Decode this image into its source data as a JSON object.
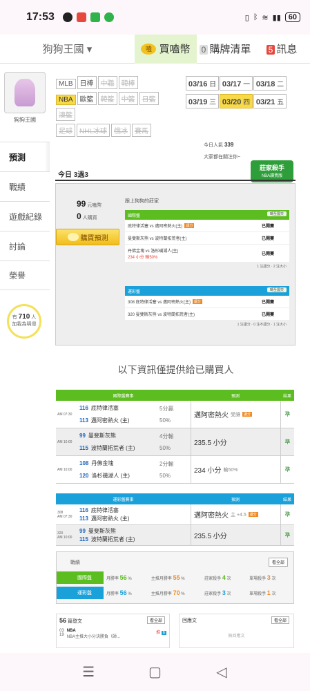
{
  "status": {
    "time": "17:53",
    "battery": "60"
  },
  "topnav": {
    "site": "狗狗王國 ▾",
    "buy_label": "買嗑幣",
    "coin_text": "嗑",
    "cart_count": "0",
    "cart_label": "購牌清單",
    "msg_count": "5",
    "msg_label": "訊息"
  },
  "sidebar": {
    "user_name": "狗狗王國",
    "items": [
      {
        "label": "預測"
      },
      {
        "label": "戰績"
      },
      {
        "label": "遊戲紀錄"
      },
      {
        "label": "討論"
      },
      {
        "label": "榮譽"
      }
    ],
    "followers_pre": "有",
    "followers": "710",
    "followers_post": "人",
    "followers_sub": "加我為明燈"
  },
  "sports": {
    "row1": [
      {
        "label": "MLB",
        "state": "normal"
      },
      {
        "label": "日棒",
        "state": "normal"
      },
      {
        "label": "中職",
        "state": "dim"
      },
      {
        "label": "韓棒",
        "state": "dim"
      }
    ],
    "row2": [
      {
        "label": "NBA",
        "state": "sel"
      },
      {
        "label": "歐籃",
        "state": "normal"
      },
      {
        "label": "韓籃",
        "state": "dim"
      },
      {
        "label": "中籃",
        "state": "dim"
      },
      {
        "label": "日籃",
        "state": "dim"
      }
    ],
    "row3": [
      {
        "label": "澳籃",
        "state": "dim"
      }
    ],
    "row4": [
      {
        "label": "足球",
        "state": "dim"
      },
      {
        "label": "NHL冰球",
        "state": "dim"
      },
      {
        "label": "俄冰",
        "state": "dim"
      },
      {
        "label": "賽馬",
        "state": "dim"
      }
    ]
  },
  "dates": [
    {
      "date": "03/16",
      "day": "日",
      "sel": false
    },
    {
      "date": "03/17",
      "day": "一",
      "sel": false
    },
    {
      "date": "03/18",
      "day": "二",
      "sel": false
    },
    {
      "date": "03/19",
      "day": "三",
      "sel": false
    },
    {
      "date": "03/20",
      "day": "四",
      "sel": true
    },
    {
      "date": "03/21",
      "day": "五",
      "sel": false
    }
  ],
  "popularity": {
    "label": "今日人氣",
    "value": "339",
    "sub": "大家都在關注你~"
  },
  "badge": {
    "line1": "莊家殺手",
    "line2": "NBA讀賣版"
  },
  "today": {
    "label": "今日 3過3"
  },
  "panel": {
    "price": "99",
    "price_unit": "元嗑幣",
    "buyers": "0",
    "buyers_unit": "人購買",
    "buy_button": "購買預測",
    "title": "跟上狗狗的莊家",
    "intl": {
      "header": "國際盤",
      "mini": "轉至國交",
      "rows": [
        {
          "text": "底特律活塞  vs  邁阿密熱火(主)",
          "tag": "讓分",
          "status": "已開賽"
        },
        {
          "text": "曼斐斯灰熊  vs  波特蘭拓荒者(主)",
          "tag": "",
          "status": "已開賽"
        },
        {
          "text": "丹佛金塊  vs  洛杉磯湖人(主)",
          "tag": "",
          "status": "已開賽"
        }
      ],
      "extra": "234 小分  輸50%",
      "foot": "1 注讓分 · 2 注大小"
    },
    "tw": {
      "header": "運彩盤",
      "mini": "轉至國交",
      "rows": [
        {
          "text": "308  底特律活塞  vs  邁阿密熱火(主)",
          "tag": "讓分",
          "status": "已開賽"
        },
        {
          "text": "320  曼斐斯灰熊  vs  波特蘭拓荒者(主)",
          "tag": "",
          "status": "已開賽"
        }
      ],
      "foot": "1 注讓分 · 0 注不讓分 · 1 注大小"
    }
  },
  "notice": "以下資訊僅提供給已購買人",
  "intl_table": {
    "headers": {
      "match": "國際盤賽事",
      "pred": "預測",
      "result": "結果"
    },
    "games": [
      {
        "time": "AM 07:30",
        "t1num": "116",
        "t1": "底特律活塞",
        "t2num": "113",
        "t2": "邁阿密熱火 (主)",
        "line1": "5分贏",
        "line2": "50%",
        "pred": "邁阿密熱火",
        "pred_sub": "受讓",
        "result": "準"
      },
      {
        "time": "AM 10:00",
        "t1num": "99",
        "t1": "曼斐斯灰熊",
        "t2num": "115",
        "t2": "波特蘭拓荒者 (主)",
        "line1": "4分輸",
        "line2": "50%",
        "pred": "235.5 小分",
        "pred_sub": "",
        "result": "準"
      },
      {
        "time": "AM 10:00",
        "t1num": "108",
        "t1": "丹佛金塊",
        "t2num": "120",
        "t2": "洛杉磯湖人 (主)",
        "line1": "2分輸",
        "line2": "50%",
        "pred": "234 小分",
        "pred_sub": "輸50%",
        "result": "準"
      }
    ]
  },
  "tw_table": {
    "headers": {
      "match": "運彩盤賽事",
      "pred": "預測",
      "result": "結果"
    },
    "games": [
      {
        "code": "308",
        "time": "AM 07:30",
        "t1num": "116",
        "t1": "底特律活塞",
        "t2num": "113",
        "t2": "邁阿密熱火 (主)",
        "pred": "邁阿密熱火",
        "pred_sub": "主 +4.5",
        "result": "準"
      },
      {
        "code": "320",
        "time": "AM 10:00",
        "t1num": "99",
        "t1": "曼斐斯灰熊",
        "t2num": "115",
        "t2": "波特蘭拓荒者 (主)",
        "pred": "235.5 小分",
        "pred_sub": "",
        "result": "準"
      }
    ]
  },
  "record": {
    "title": "戰績",
    "all": "看全部",
    "rows": [
      {
        "label": "國際盤",
        "c1": "月勝率",
        "v1": "56",
        "u1": "%",
        "c2": "主推月勝率",
        "v2": "55",
        "u2": "%",
        "c3": "莊家殺手",
        "v3": "4",
        "u3": "次",
        "c4": "單場殺手",
        "v4": "3",
        "u4": "次"
      },
      {
        "label": "運彩盤",
        "c1": "月勝率",
        "v1": "56",
        "u1": "%",
        "c2": "主推月勝率",
        "v2": "70",
        "u2": "%",
        "c3": "莊家殺手",
        "v3": "3",
        "u3": "次",
        "c4": "單場殺手",
        "v4": "1",
        "u4": "次"
      }
    ]
  },
  "bottom": {
    "posts_count": "56",
    "posts_label": "篇發文",
    "posts_all": "看全部",
    "post_date": "03",
    "post_date2": "19",
    "post_league": "NBA",
    "post_title": "NBA主推大小分決勝負（師...",
    "post_tag": "推",
    "post_num": "6",
    "reply_label": "回應文",
    "reply_all": "看全部",
    "reply_empty": "無回應文"
  },
  "colors": {
    "green": "#5bbd1f",
    "blue": "#1ba1d9",
    "yellow": "#f8d948",
    "red": "#e6483d"
  }
}
